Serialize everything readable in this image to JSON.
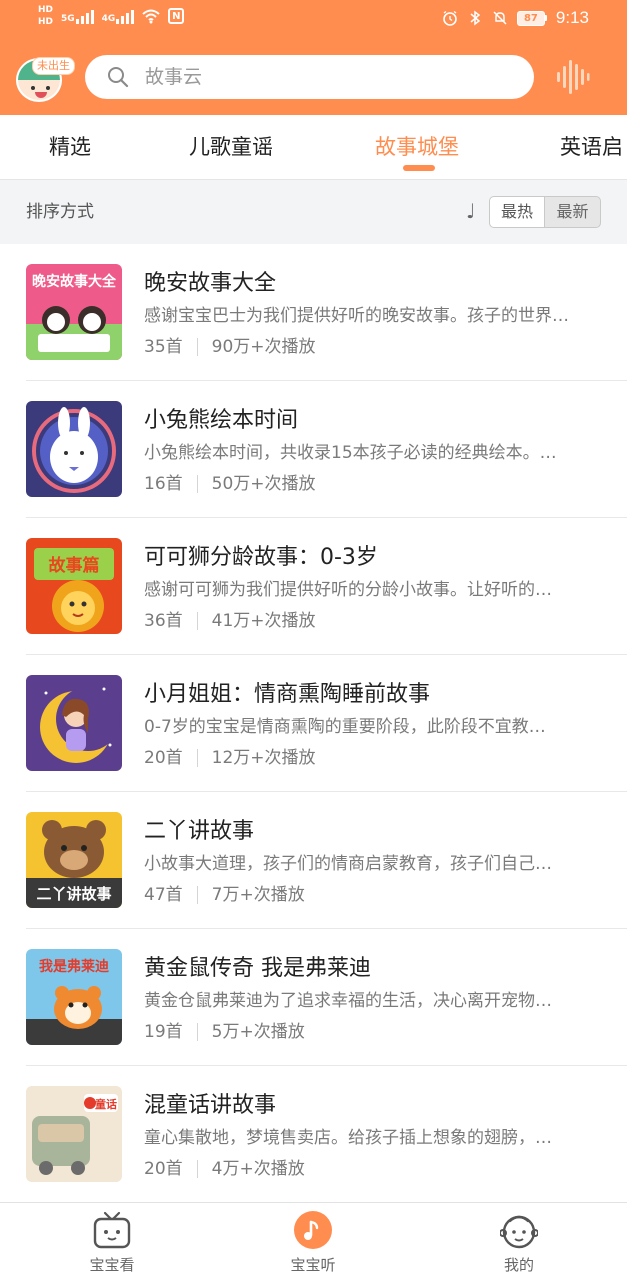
{
  "status_bar": {
    "hd_top": "HD",
    "hd_bottom": "HD",
    "signal_1": "5G",
    "signal_2": "4G",
    "nfc": "N",
    "battery": "87",
    "time": "9:13"
  },
  "header": {
    "avatar_badge": "未出生",
    "search_placeholder": "故事云"
  },
  "tabs": [
    {
      "label": "精选",
      "active": false
    },
    {
      "label": "儿歌童谣",
      "active": false
    },
    {
      "label": "故事城堡",
      "active": true
    },
    {
      "label": "英语启",
      "active": false
    }
  ],
  "sort": {
    "label": "排序方式",
    "glyph": "♩",
    "options": [
      "最热",
      "最新"
    ],
    "selected": "最热"
  },
  "items": [
    {
      "title": "晚安故事大全",
      "desc": "感谢宝宝巴士为我们提供好听的晚安故事。孩子的世界…",
      "count": "35首",
      "plays": "90万+次播放",
      "cover_text": "晚安故事大全",
      "accent": "#ee5b8a"
    },
    {
      "title": "小兔熊绘本时间",
      "desc": "小兔熊绘本时间，共收录15本孩子必读的经典绘本。…",
      "count": "16首",
      "plays": "50万+次播放",
      "cover_text": "",
      "accent": "#3b3a7a"
    },
    {
      "title": "可可狮分龄故事：0-3岁",
      "desc": "感谢可可狮为我们提供好听的分龄小故事。让好听的…",
      "count": "36首",
      "plays": "41万+次播放",
      "cover_text": "故事篇",
      "accent": "#e8481e"
    },
    {
      "title": "小月姐姐：情商熏陶睡前故事",
      "desc": "0-7岁的宝宝是情商熏陶的重要阶段，此阶段不宜教…",
      "count": "20首",
      "plays": "12万+次播放",
      "cover_text": "",
      "accent": "#5b3e8e"
    },
    {
      "title": "二丫讲故事",
      "desc": "小故事大道理，孩子们的情商启蒙教育，孩子们自己…",
      "count": "47首",
      "plays": "7万+次播放",
      "cover_text": "二丫讲故事",
      "accent": "#f5c230"
    },
    {
      "title": "黄金鼠传奇 我是弗莱迪",
      "desc": "黄金仓鼠弗莱迪为了追求幸福的生活，决心离开宠物…",
      "count": "19首",
      "plays": "5万+次播放",
      "cover_text": "我是弗莱迪",
      "accent": "#7ec7ea"
    },
    {
      "title": "混童话讲故事",
      "desc": "童心集散地，梦境售卖店。给孩子插上想象的翅膀，…",
      "count": "20首",
      "plays": "4万+次播放",
      "cover_text": "童话",
      "accent": "#d9c7a8"
    }
  ],
  "bottom_nav": [
    {
      "label": "宝宝看",
      "icon": "tv-icon",
      "active": false
    },
    {
      "label": "宝宝听",
      "icon": "music-note-icon",
      "active": true
    },
    {
      "label": "我的",
      "icon": "baby-face-icon",
      "active": false
    }
  ],
  "colors": {
    "accent": "#ff8d4f",
    "header_bg": "#ff8d4f",
    "sortbar_bg": "#f3f4f6"
  }
}
